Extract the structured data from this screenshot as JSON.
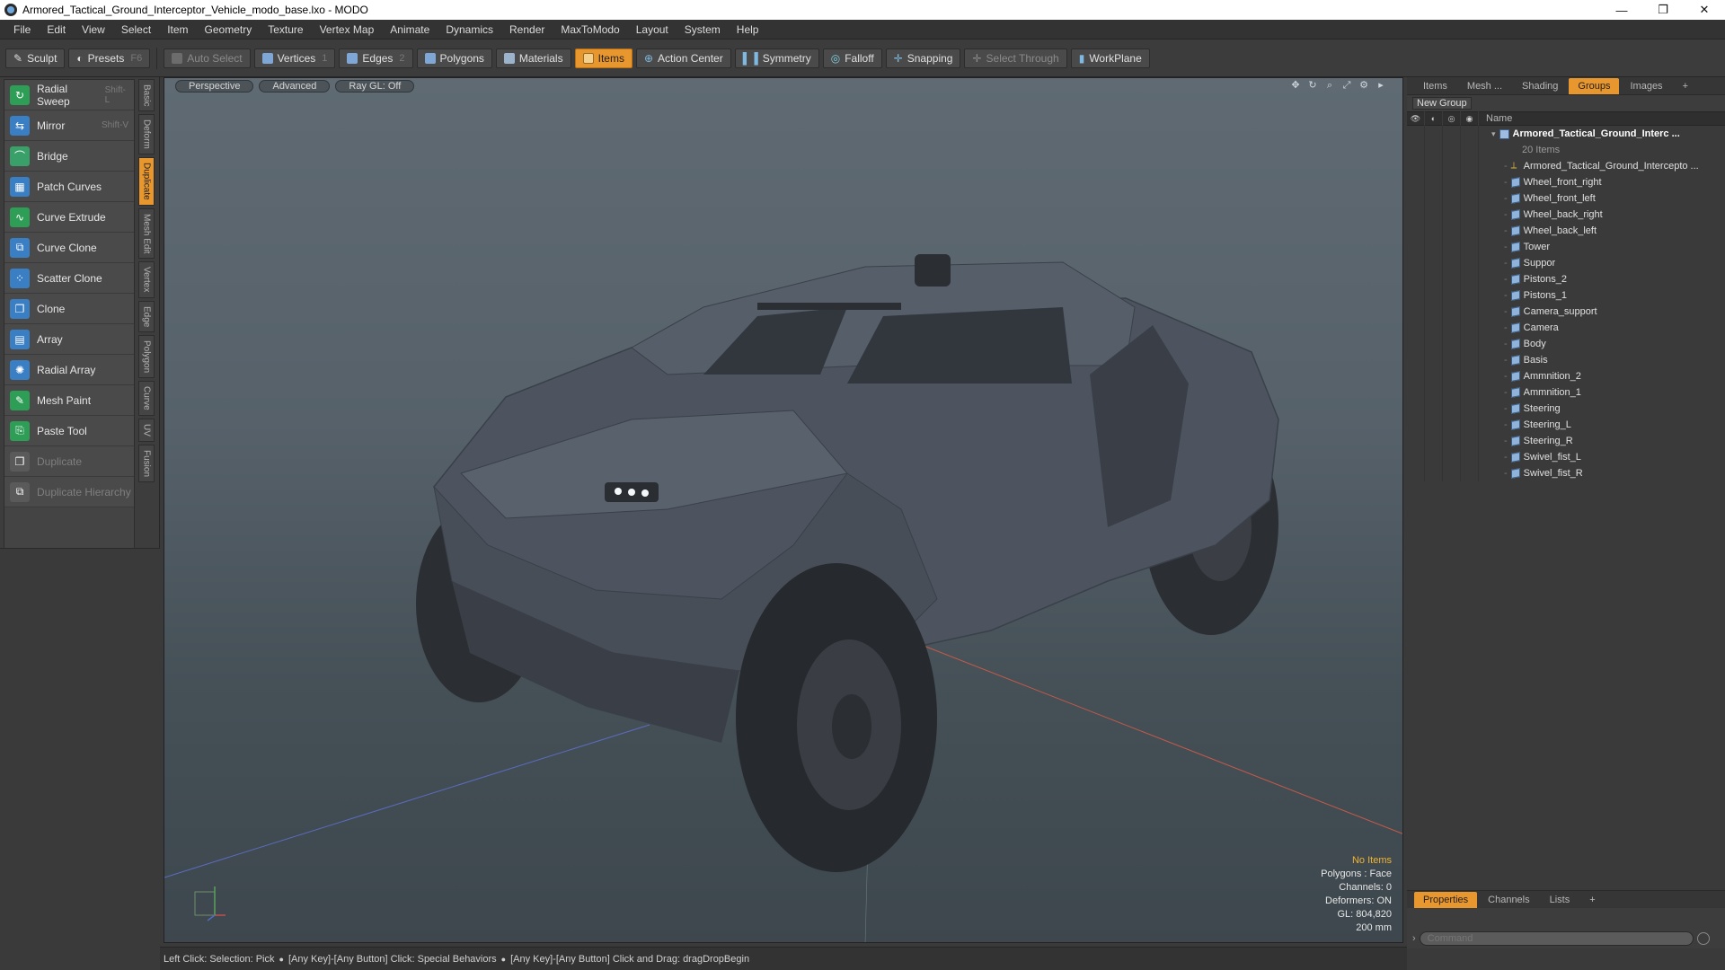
{
  "window": {
    "title": "Armored_Tactical_Ground_Interceptor_Vehicle_modo_base.lxo - MODO",
    "minimize": "—",
    "maximize": "❐",
    "close": "✕"
  },
  "menu": [
    "File",
    "Edit",
    "View",
    "Select",
    "Item",
    "Geometry",
    "Texture",
    "Vertex Map",
    "Animate",
    "Dynamics",
    "Render",
    "MaxToModo",
    "Layout",
    "System",
    "Help"
  ],
  "toolbar": {
    "sculpt": "Sculpt",
    "presets": "Presets",
    "presets_key": "F6",
    "auto_select": "Auto Select",
    "vertices": "Vertices",
    "vertices_num": "1",
    "edges": "Edges",
    "edges_num": "2",
    "polygons": "Polygons",
    "materials": "Materials",
    "items": "Items",
    "action_center": "Action Center",
    "symmetry": "Symmetry",
    "falloff": "Falloff",
    "snapping": "Snapping",
    "select_through": "Select Through",
    "workplane": "WorkPlane"
  },
  "tools": [
    {
      "label": "Radial Sweep",
      "shortcut": "Shift-L",
      "color": "#2e9e57",
      "disabled": false
    },
    {
      "label": "Mirror",
      "shortcut": "Shift-V",
      "color": "#3a7fc4",
      "disabled": false
    },
    {
      "label": "Bridge",
      "shortcut": "",
      "color": "#3aa06a",
      "disabled": false
    },
    {
      "label": "Patch Curves",
      "shortcut": "",
      "color": "#3a7fc4",
      "disabled": false
    },
    {
      "label": "Curve Extrude",
      "shortcut": "",
      "color": "#2e9e57",
      "disabled": false
    },
    {
      "label": "Curve Clone",
      "shortcut": "",
      "color": "#3a7fc4",
      "disabled": false
    },
    {
      "label": "Scatter Clone",
      "shortcut": "",
      "color": "#3a7fc4",
      "disabled": false
    },
    {
      "label": "Clone",
      "shortcut": "",
      "color": "#3a7fc4",
      "disabled": false
    },
    {
      "label": "Array",
      "shortcut": "",
      "color": "#3a7fc4",
      "disabled": false
    },
    {
      "label": "Radial Array",
      "shortcut": "",
      "color": "#3a7fc4",
      "disabled": false
    },
    {
      "label": "Mesh Paint",
      "shortcut": "",
      "color": "#2e9e57",
      "disabled": false
    },
    {
      "label": "Paste Tool",
      "shortcut": "",
      "color": "#2e9e57",
      "disabled": false
    },
    {
      "label": "Duplicate",
      "shortcut": "",
      "color": "#5a5a5a",
      "disabled": true
    },
    {
      "label": "Duplicate Hierarchy",
      "shortcut": "",
      "color": "#5a5a5a",
      "disabled": true
    }
  ],
  "vertical_tabs": [
    "Basic",
    "Deform",
    "Duplicate",
    "Mesh Edit",
    "Vertex",
    "Edge",
    "Polygon",
    "Curve",
    "UV",
    "Fusion"
  ],
  "viewport": {
    "perspective": "Perspective",
    "advanced": "Advanced",
    "raygl": "Ray GL: Off",
    "info": {
      "no_items": "No Items",
      "polygons": "Polygons : Face",
      "channels": "Channels: 0",
      "deformers": "Deformers: ON",
      "gl": "GL: 804,820",
      "scale": "200 mm"
    }
  },
  "right_panel": {
    "tabs": [
      "Items",
      "Mesh ...",
      "Shading",
      "Groups",
      "Images",
      "+"
    ],
    "active_tab": "Groups",
    "new_group": "New Group",
    "name_header": "Name",
    "group_name": "Armored_Tactical_Ground_Interc ...",
    "group_count": "20 Items",
    "items": [
      {
        "name": "Armored_Tactical_Ground_Intercepto ...",
        "type": "locator"
      },
      {
        "name": "Wheel_front_right",
        "type": "mesh"
      },
      {
        "name": "Wheel_front_left",
        "type": "mesh"
      },
      {
        "name": "Wheel_back_right",
        "type": "mesh"
      },
      {
        "name": "Wheel_back_left",
        "type": "mesh"
      },
      {
        "name": "Tower",
        "type": "mesh"
      },
      {
        "name": "Suppor",
        "type": "mesh"
      },
      {
        "name": "Pistons_2",
        "type": "mesh"
      },
      {
        "name": "Pistons_1",
        "type": "mesh"
      },
      {
        "name": "Camera_support",
        "type": "mesh"
      },
      {
        "name": "Camera",
        "type": "mesh"
      },
      {
        "name": "Body",
        "type": "mesh"
      },
      {
        "name": "Basis",
        "type": "mesh"
      },
      {
        "name": "Ammnition_2",
        "type": "mesh"
      },
      {
        "name": "Ammnition_1",
        "type": "mesh"
      },
      {
        "name": "Steering",
        "type": "mesh"
      },
      {
        "name": "Steering_L",
        "type": "mesh"
      },
      {
        "name": "Steering_R",
        "type": "mesh"
      },
      {
        "name": "Swivel_fist_L",
        "type": "mesh"
      },
      {
        "name": "Swivel_fist_R",
        "type": "mesh"
      }
    ],
    "bottom_tabs": [
      "Properties",
      "Channels",
      "Lists",
      "+"
    ],
    "command_placeholder": "Command"
  },
  "status": {
    "text1": "Left Click: Selection: Pick",
    "text2": "[Any Key]-[Any Button] Click: Special Behaviors",
    "text3": "[Any Key]-[Any Button] Click and Drag: dragDropBegin"
  },
  "colors": {
    "accent": "#e8972f",
    "panel": "#3d3d3d",
    "vehicle": "#4a515c"
  }
}
